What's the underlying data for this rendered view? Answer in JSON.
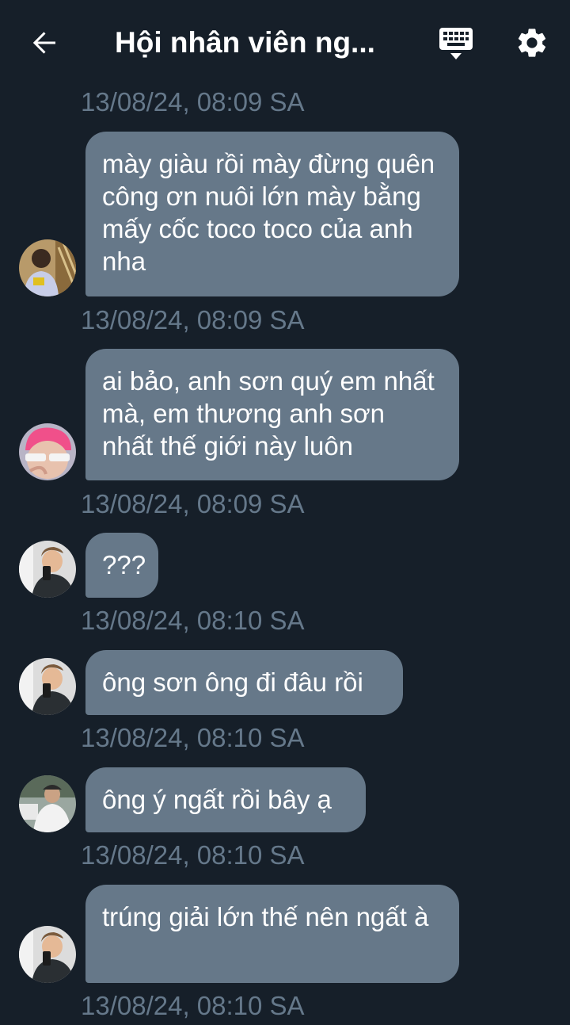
{
  "header": {
    "title": "Hội nhân viên ng..."
  },
  "icons": {
    "back": "arrow-back-icon",
    "keyboard": "keyboard-icon",
    "settings": "gear-icon"
  },
  "colors": {
    "background": "#161f29",
    "bubble": "#667889",
    "timestamp": "#65788a"
  },
  "messages": [
    {
      "timestamp": "13/08/24, 08:09 SA",
      "text": ""
    },
    {
      "timestamp": "13/08/24, 08:09 SA",
      "text": "mày giàu rồi mày đừng quên công ơn nuôi lớn mày bằng mấy cốc toco toco của anh nha"
    },
    {
      "timestamp": "13/08/24, 08:09 SA",
      "text": "ai bảo, anh sơn quý em nhất mà, em thương anh sơn nhất thế giới này luôn"
    },
    {
      "timestamp": "13/08/24, 08:10 SA",
      "text": "???"
    },
    {
      "timestamp": "13/08/24, 08:10 SA",
      "text": "ông sơn ông đi đâu rồi"
    },
    {
      "timestamp": "13/08/24, 08:10 SA",
      "text": "ông ý ngất rồi bây ạ"
    },
    {
      "timestamp": "13/08/24, 08:10 SA",
      "text": "trúng giải lớn thế nên ngất à"
    }
  ]
}
